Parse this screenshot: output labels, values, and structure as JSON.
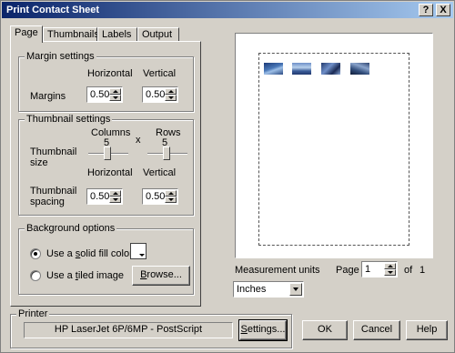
{
  "window": {
    "title": "Print Contact Sheet",
    "help_glyph": "?",
    "close_glyph": "X"
  },
  "tabs": [
    {
      "label": "Page",
      "active": true
    },
    {
      "label": "Thumbnails",
      "active": false
    },
    {
      "label": "Labels",
      "active": false
    },
    {
      "label": "Output",
      "active": false
    }
  ],
  "margin_settings": {
    "title": "Margin settings",
    "horizontal_label": "Horizontal",
    "vertical_label": "Vertical",
    "row_label": "Margins",
    "horizontal_value": "0.50",
    "vertical_value": "0.50"
  },
  "thumbnail_settings": {
    "title": "Thumbnail settings",
    "columns_label": "Columns",
    "columns_value": "5",
    "x_label": "x",
    "rows_label": "Rows",
    "rows_value": "5",
    "size_label_line1": "Thumbnail",
    "size_label_line2": "size",
    "horizontal_label": "Horizontal",
    "vertical_label": "Vertical",
    "spacing_label_line1": "Thumbnail",
    "spacing_label_line2": "spacing",
    "spacing_horizontal_value": "0.50",
    "spacing_vertical_value": "0.50"
  },
  "background_options": {
    "title": "Background options",
    "solid_fill_label": "Use a solid fill color",
    "solid_fill_selected": true,
    "fill_color": "#ffffff",
    "tiled_image_label": "Use a tiled image",
    "tiled_image_selected": false,
    "browse_button": "Browse..."
  },
  "measurement": {
    "label": "Measurement units",
    "selected": "Inches"
  },
  "page_nav": {
    "label": "Page",
    "value": "1",
    "of_label": "of",
    "total": "1"
  },
  "printer": {
    "title": "Printer",
    "name": "HP LaserJet 6P/6MP - PostScript",
    "settings_button": "Settings..."
  },
  "buttons": {
    "ok": "OK",
    "cancel": "Cancel",
    "help": "Help"
  },
  "colors": {
    "titlebar_start": "#0a246a",
    "titlebar_end": "#a6caf0",
    "dialog_bg": "#d4d0c8"
  }
}
